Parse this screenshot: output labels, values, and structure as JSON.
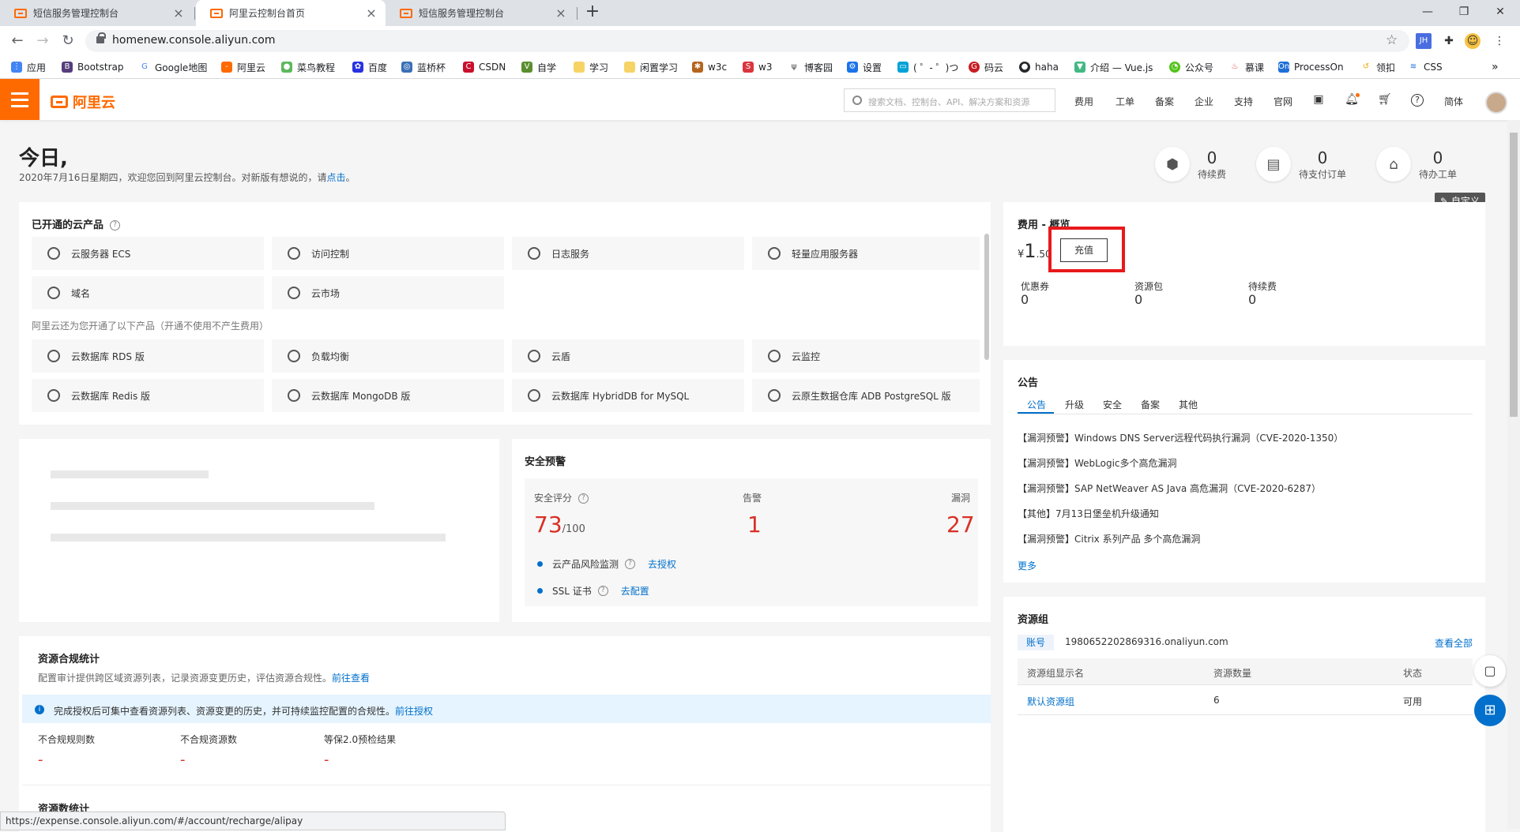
{
  "browser": {
    "tabs": [
      {
        "title": "短信服务管理控制台"
      },
      {
        "title": "阿里云控制台首页"
      },
      {
        "title": "短信服务管理控制台"
      }
    ],
    "new_tab": "+",
    "url": "homenew.console.aliyun.com",
    "bookmarks": [
      "应用",
      "Bootstrap",
      "Google地图",
      "阿里云",
      "菜鸟教程",
      "百度",
      "蓝桥杯",
      "CSDN",
      "自学",
      "学习",
      "闲置学习",
      "w3c",
      "w3",
      "博客园",
      "设置",
      "( ゜- ゜)つ",
      "码云",
      "haha",
      "介绍 — Vue.js",
      "公众号",
      "慕课",
      "ProcessOn",
      "领扣",
      "CSS"
    ],
    "ext_badge": "JH",
    "status_url": "https://expense.console.aliyun.com/#/account/recharge/alipay"
  },
  "header": {
    "logo": "阿里云",
    "search_placeholder": "搜索文档、控制台、API、解决方案和资源",
    "nav": [
      "费用",
      "工单",
      "备案",
      "企业",
      "支持",
      "官网"
    ],
    "lang": "简体"
  },
  "greeting": {
    "title": "今日,",
    "subtitle": "2020年7月16日星期四，欢迎您回到阿里云控制台。对新版有想说的，请",
    "link": "点击",
    "tail": "。"
  },
  "stats": [
    {
      "value": "0",
      "label": "待续费"
    },
    {
      "value": "0",
      "label": "待支付订单"
    },
    {
      "value": "0",
      "label": "待办工单"
    }
  ],
  "customize": "自定义",
  "products": {
    "title": "已开通的云产品",
    "opened": [
      "云服务器 ECS",
      "访问控制",
      "日志服务",
      "轻量应用服务器",
      "域名",
      "云市场"
    ],
    "note": "阿里云还为您开通了以下产品（开通不使用不产生费用）",
    "free": [
      "云数据库 RDS 版",
      "负载均衡",
      "云盾",
      "云监控",
      "云数据库 Redis 版",
      "云数据库 MongoDB 版",
      "云数据库 HybridDB for MySQL",
      "云原生数据仓库 ADB PostgreSQL 版"
    ]
  },
  "security": {
    "title": "安全预警",
    "score_label": "安全评分",
    "score": "73",
    "score_max": "/100",
    "alarm_label": "告警",
    "alarm": "1",
    "vuln_label": "漏洞",
    "vuln": "27",
    "items": [
      {
        "label": "云产品风险监测",
        "action": "去授权"
      },
      {
        "label": "SSL 证书",
        "action": "去配置"
      }
    ]
  },
  "compliance": {
    "title": "资源合规统计",
    "desc": "配置审计提供跨区域资源列表，记录资源变更历史，评估资源合规性。",
    "desc_link": "前往查看",
    "info": "完成授权后可集中查看资源列表、资源变更的历史，并可持续监控配置的合规性。",
    "info_link": "前往授权",
    "metrics": [
      {
        "label": "不合规规则数",
        "value": "-"
      },
      {
        "label": "不合规资源数",
        "value": "-"
      },
      {
        "label": "等保2.0预检结果",
        "value": "-"
      }
    ],
    "next_title": "资源数统计"
  },
  "billing": {
    "title": "费用 - 概览",
    "currency": "¥",
    "amount_int": "1",
    "amount_dec": ".50",
    "recharge": "充值",
    "items": [
      {
        "label": "优惠券",
        "value": "0"
      },
      {
        "label": "资源包",
        "value": "0"
      },
      {
        "label": "待续费",
        "value": "0"
      }
    ]
  },
  "announcements": {
    "title": "公告",
    "tabs": [
      "公告",
      "升级",
      "安全",
      "备案",
      "其他"
    ],
    "items": [
      "【漏洞预警】Windows DNS Server远程代码执行漏洞（CVE-2020-1350）",
      "【漏洞预警】WebLogic多个高危漏洞",
      "【漏洞预警】SAP NetWeaver AS Java 高危漏洞（CVE-2020-6287）",
      "【其他】7月13日堡垒机升级通知",
      "【漏洞预警】Citrix 系列产品 多个高危漏洞"
    ],
    "more": "更多"
  },
  "resource_group": {
    "title": "资源组",
    "account_tag": "账号",
    "account": "1980652202869316.onaliyun.com",
    "view_all": "查看全部",
    "columns": [
      "资源组显示名",
      "资源数量",
      "状态"
    ],
    "rows": [
      [
        "默认资源组",
        "6",
        "可用"
      ]
    ]
  }
}
